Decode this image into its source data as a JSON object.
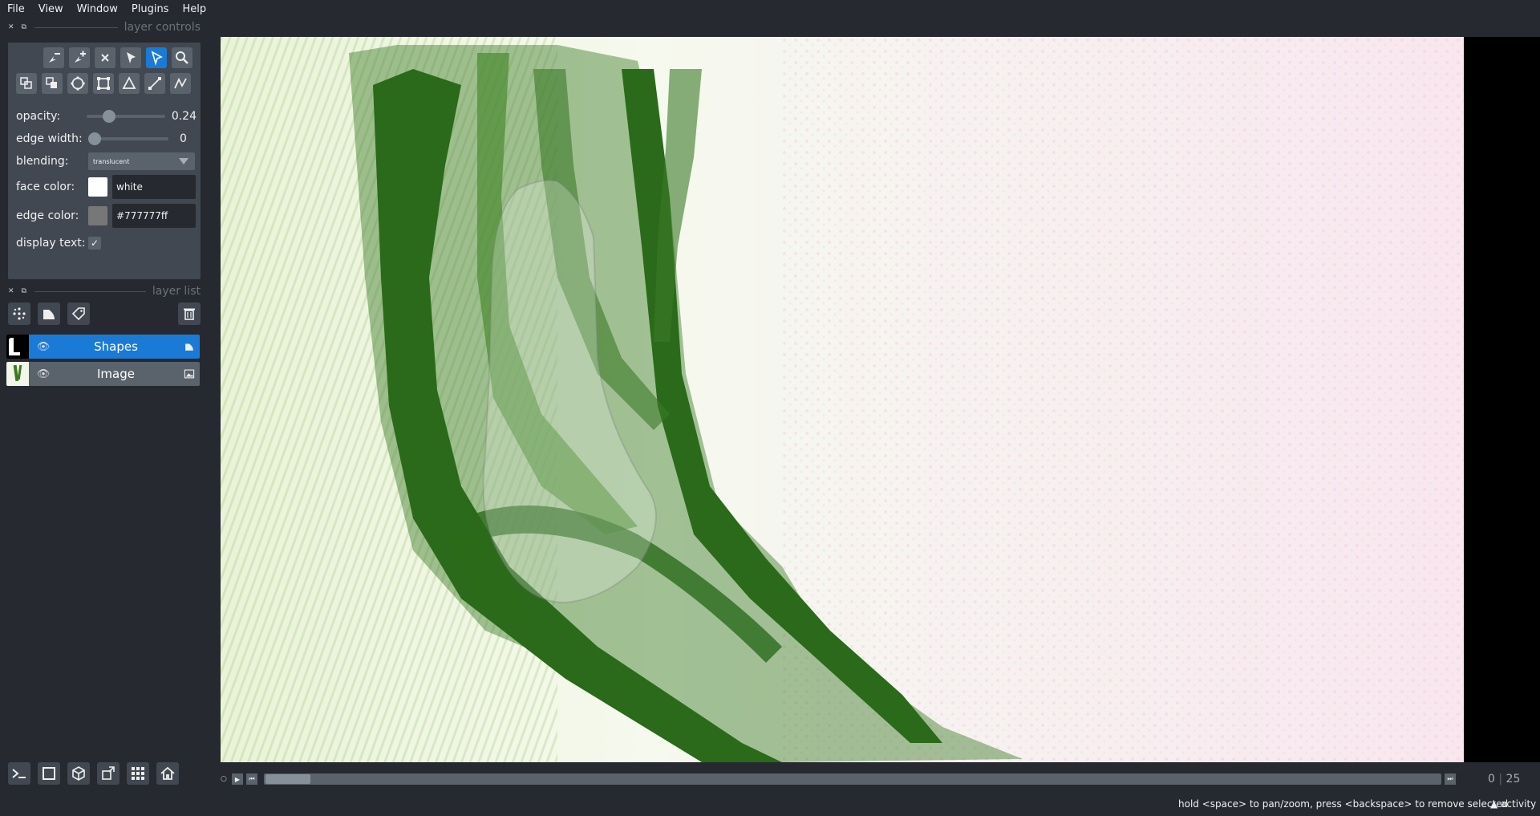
{
  "menu": [
    "File",
    "View",
    "Window",
    "Plugins",
    "Help"
  ],
  "layer_controls": {
    "title": "layer controls",
    "opacity_label": "opacity:",
    "opacity_value": "0.24",
    "edge_width_label": "edge width:",
    "edge_width_value": "0",
    "blending_label": "blending:",
    "blending_value": "translucent",
    "face_color_label": "face color:",
    "face_color_value": "white",
    "face_color_hex": "#ffffff",
    "edge_color_label": "edge color:",
    "edge_color_value": "#777777ff",
    "edge_color_hex": "#777777",
    "display_text_label": "display text:",
    "display_text_checked": "✓"
  },
  "layer_list": {
    "title": "layer list",
    "layers": [
      {
        "name": "Shapes",
        "selected": true
      },
      {
        "name": "Image",
        "selected": false
      }
    ]
  },
  "dims": {
    "current": "0",
    "total": "25"
  },
  "status": {
    "message": "hold <space> to pan/zoom, press <backspace> to remove selected",
    "activity": "activity"
  },
  "colors": {
    "accent": "#1a7bd6",
    "bg": "#262930",
    "panel": "#414851"
  }
}
